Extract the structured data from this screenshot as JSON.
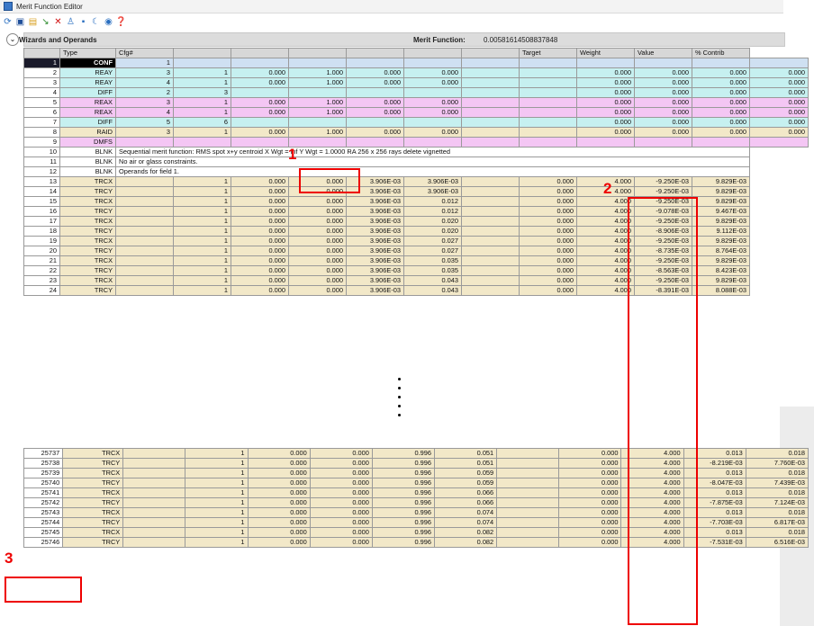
{
  "window": {
    "title": "Merit Function Editor"
  },
  "toolbar": {
    "icons": [
      "refresh-icon",
      "save-icon",
      "open-icon",
      "insert-icon",
      "delete-icon",
      "wizard-icon",
      "operand-icon",
      "sync-icon",
      "eye-icon",
      "help-icon"
    ]
  },
  "panel": {
    "label": "Wizards and Operands",
    "merit_label": "Merit Function:",
    "merit_value": "0.00581614508837848"
  },
  "columns": [
    "",
    "Type",
    "Cfg#",
    "",
    "",
    "",
    "",
    "",
    "",
    "Target",
    "Weight",
    "Value",
    "% Contrib"
  ],
  "top_rows": [
    {
      "n": "1",
      "type": "CONF",
      "style": "conf",
      "c": [
        "1",
        "",
        "",
        "",
        "",
        "",
        "",
        ""
      ],
      "t": "",
      "w": "",
      "v": "",
      "p": ""
    },
    {
      "n": "2",
      "type": "REAY",
      "style": "cyan",
      "c": [
        "3",
        "1",
        "0.000",
        "1.000",
        "0.000",
        "0.000",
        "",
        ""
      ],
      "t": "0.000",
      "w": "0.000",
      "v": "0.000",
      "p": "0.000"
    },
    {
      "n": "3",
      "type": "REAY",
      "style": "cyan",
      "c": [
        "4",
        "1",
        "0.000",
        "1.000",
        "0.000",
        "0.000",
        "",
        ""
      ],
      "t": "0.000",
      "w": "0.000",
      "v": "0.000",
      "p": "0.000"
    },
    {
      "n": "4",
      "type": "DIFF",
      "style": "cyan",
      "c": [
        "2",
        "3",
        "",
        "",
        "",
        "",
        "",
        ""
      ],
      "t": "0.000",
      "w": "0.000",
      "v": "0.000",
      "p": "0.000"
    },
    {
      "n": "5",
      "type": "REAX",
      "style": "mag",
      "c": [
        "3",
        "1",
        "0.000",
        "1.000",
        "0.000",
        "0.000",
        "",
        ""
      ],
      "t": "0.000",
      "w": "0.000",
      "v": "0.000",
      "p": "0.000"
    },
    {
      "n": "6",
      "type": "REAX",
      "style": "mag",
      "c": [
        "4",
        "1",
        "0.000",
        "1.000",
        "0.000",
        "0.000",
        "",
        ""
      ],
      "t": "0.000",
      "w": "0.000",
      "v": "0.000",
      "p": "0.000"
    },
    {
      "n": "7",
      "type": "DIFF",
      "style": "cyan",
      "c": [
        "5",
        "6",
        "",
        "",
        "",
        "",
        "",
        ""
      ],
      "t": "0.000",
      "w": "0.000",
      "v": "0.000",
      "p": "0.000"
    },
    {
      "n": "8",
      "type": "RAID",
      "style": "beige",
      "c": [
        "3",
        "1",
        "0.000",
        "1.000",
        "0.000",
        "0.000",
        "",
        ""
      ],
      "t": "0.000",
      "w": "0.000",
      "v": "0.000",
      "p": "0.000"
    },
    {
      "n": "9",
      "type": "DMFS",
      "style": "mag",
      "c": [
        "",
        "",
        "",
        "",
        "",
        "",
        "",
        ""
      ],
      "t": "",
      "w": "",
      "v": "",
      "p": ""
    }
  ],
  "blnk_rows": [
    {
      "n": "10",
      "type": "BLNK",
      "text": "Sequential merit function: RMS spot x+y centroid X Wgt = inf Y Wgt = 1.0000 RA 256 x 256 rays delete vignetted"
    },
    {
      "n": "11",
      "type": "BLNK",
      "text": "No air or glass constraints."
    },
    {
      "n": "12",
      "type": "BLNK",
      "text": "Operands for field 1."
    }
  ],
  "trc_rows": [
    {
      "n": "13",
      "type": "TRCX",
      "c3": "1",
      "c4": "0.000",
      "c5": "0.000",
      "c6": "3.906E-03",
      "c7": "3.906E-03",
      "t": "0.000",
      "w": "4.000",
      "v": "-9.250E-03",
      "p": "9.829E-03"
    },
    {
      "n": "14",
      "type": "TRCY",
      "c3": "1",
      "c4": "0.000",
      "c5": "0.000",
      "c6": "3.906E-03",
      "c7": "3.906E-03",
      "t": "0.000",
      "w": "4.000",
      "v": "-9.250E-03",
      "p": "9.829E-03"
    },
    {
      "n": "15",
      "type": "TRCX",
      "c3": "1",
      "c4": "0.000",
      "c5": "0.000",
      "c6": "3.906E-03",
      "c7": "0.012",
      "t": "0.000",
      "w": "4.000",
      "v": "-9.250E-03",
      "p": "9.829E-03"
    },
    {
      "n": "16",
      "type": "TRCY",
      "c3": "1",
      "c4": "0.000",
      "c5": "0.000",
      "c6": "3.906E-03",
      "c7": "0.012",
      "t": "0.000",
      "w": "4.000",
      "v": "-9.078E-03",
      "p": "9.467E-03"
    },
    {
      "n": "17",
      "type": "TRCX",
      "c3": "1",
      "c4": "0.000",
      "c5": "0.000",
      "c6": "3.906E-03",
      "c7": "0.020",
      "t": "0.000",
      "w": "4.000",
      "v": "-9.250E-03",
      "p": "9.829E-03"
    },
    {
      "n": "18",
      "type": "TRCY",
      "c3": "1",
      "c4": "0.000",
      "c5": "0.000",
      "c6": "3.906E-03",
      "c7": "0.020",
      "t": "0.000",
      "w": "4.000",
      "v": "-8.906E-03",
      "p": "9.112E-03"
    },
    {
      "n": "19",
      "type": "TRCX",
      "c3": "1",
      "c4": "0.000",
      "c5": "0.000",
      "c6": "3.906E-03",
      "c7": "0.027",
      "t": "0.000",
      "w": "4.000",
      "v": "-9.250E-03",
      "p": "9.829E-03"
    },
    {
      "n": "20",
      "type": "TRCY",
      "c3": "1",
      "c4": "0.000",
      "c5": "0.000",
      "c6": "3.906E-03",
      "c7": "0.027",
      "t": "0.000",
      "w": "4.000",
      "v": "-8.735E-03",
      "p": "8.764E-03"
    },
    {
      "n": "21",
      "type": "TRCX",
      "c3": "1",
      "c4": "0.000",
      "c5": "0.000",
      "c6": "3.906E-03",
      "c7": "0.035",
      "t": "0.000",
      "w": "4.000",
      "v": "-9.250E-03",
      "p": "9.829E-03"
    },
    {
      "n": "22",
      "type": "TRCY",
      "c3": "1",
      "c4": "0.000",
      "c5": "0.000",
      "c6": "3.906E-03",
      "c7": "0.035",
      "t": "0.000",
      "w": "4.000",
      "v": "-8.563E-03",
      "p": "8.423E-03"
    },
    {
      "n": "23",
      "type": "TRCX",
      "c3": "1",
      "c4": "0.000",
      "c5": "0.000",
      "c6": "3.906E-03",
      "c7": "0.043",
      "t": "0.000",
      "w": "4.000",
      "v": "-9.250E-03",
      "p": "9.829E-03"
    },
    {
      "n": "24",
      "type": "TRCY",
      "c3": "1",
      "c4": "0.000",
      "c5": "0.000",
      "c6": "3.906E-03",
      "c7": "0.043",
      "t": "0.000",
      "w": "4.000",
      "v": "-8.391E-03",
      "p": "8.088E-03"
    }
  ],
  "bottom_rows": [
    {
      "n": "25737",
      "type": "TRCX",
      "c3": "1",
      "c4": "0.000",
      "c5": "0.000",
      "c6": "0.996",
      "c7": "0.051",
      "t": "0.000",
      "w": "4.000",
      "v": "0.013",
      "p": "0.018"
    },
    {
      "n": "25738",
      "type": "TRCY",
      "c3": "1",
      "c4": "0.000",
      "c5": "0.000",
      "c6": "0.996",
      "c7": "0.051",
      "t": "0.000",
      "w": "4.000",
      "v": "-8.219E-03",
      "p": "7.760E-03"
    },
    {
      "n": "25739",
      "type": "TRCX",
      "c3": "1",
      "c4": "0.000",
      "c5": "0.000",
      "c6": "0.996",
      "c7": "0.059",
      "t": "0.000",
      "w": "4.000",
      "v": "0.013",
      "p": "0.018"
    },
    {
      "n": "25740",
      "type": "TRCY",
      "c3": "1",
      "c4": "0.000",
      "c5": "0.000",
      "c6": "0.996",
      "c7": "0.059",
      "t": "0.000",
      "w": "4.000",
      "v": "-8.047E-03",
      "p": "7.439E-03"
    },
    {
      "n": "25741",
      "type": "TRCX",
      "c3": "1",
      "c4": "0.000",
      "c5": "0.000",
      "c6": "0.996",
      "c7": "0.066",
      "t": "0.000",
      "w": "4.000",
      "v": "0.013",
      "p": "0.018"
    },
    {
      "n": "25742",
      "type": "TRCY",
      "c3": "1",
      "c4": "0.000",
      "c5": "0.000",
      "c6": "0.996",
      "c7": "0.066",
      "t": "0.000",
      "w": "4.000",
      "v": "-7.875E-03",
      "p": "7.124E-03"
    },
    {
      "n": "25743",
      "type": "TRCX",
      "c3": "1",
      "c4": "0.000",
      "c5": "0.000",
      "c6": "0.996",
      "c7": "0.074",
      "t": "0.000",
      "w": "4.000",
      "v": "0.013",
      "p": "0.018"
    },
    {
      "n": "25744",
      "type": "TRCY",
      "c3": "1",
      "c4": "0.000",
      "c5": "0.000",
      "c6": "0.996",
      "c7": "0.074",
      "t": "0.000",
      "w": "4.000",
      "v": "-7.703E-03",
      "p": "6.817E-03"
    },
    {
      "n": "25745",
      "type": "TRCX",
      "c3": "1",
      "c4": "0.000",
      "c5": "0.000",
      "c6": "0.996",
      "c7": "0.082",
      "t": "0.000",
      "w": "4.000",
      "v": "0.013",
      "p": "0.018"
    },
    {
      "n": "25746",
      "type": "TRCY",
      "c3": "1",
      "c4": "0.000",
      "c5": "0.000",
      "c6": "0.996",
      "c7": "0.082",
      "t": "0.000",
      "w": "4.000",
      "v": "-7.531E-03",
      "p": "6.516E-03"
    }
  ],
  "annotations": {
    "label1": "1",
    "label2": "2",
    "label3": "3"
  }
}
